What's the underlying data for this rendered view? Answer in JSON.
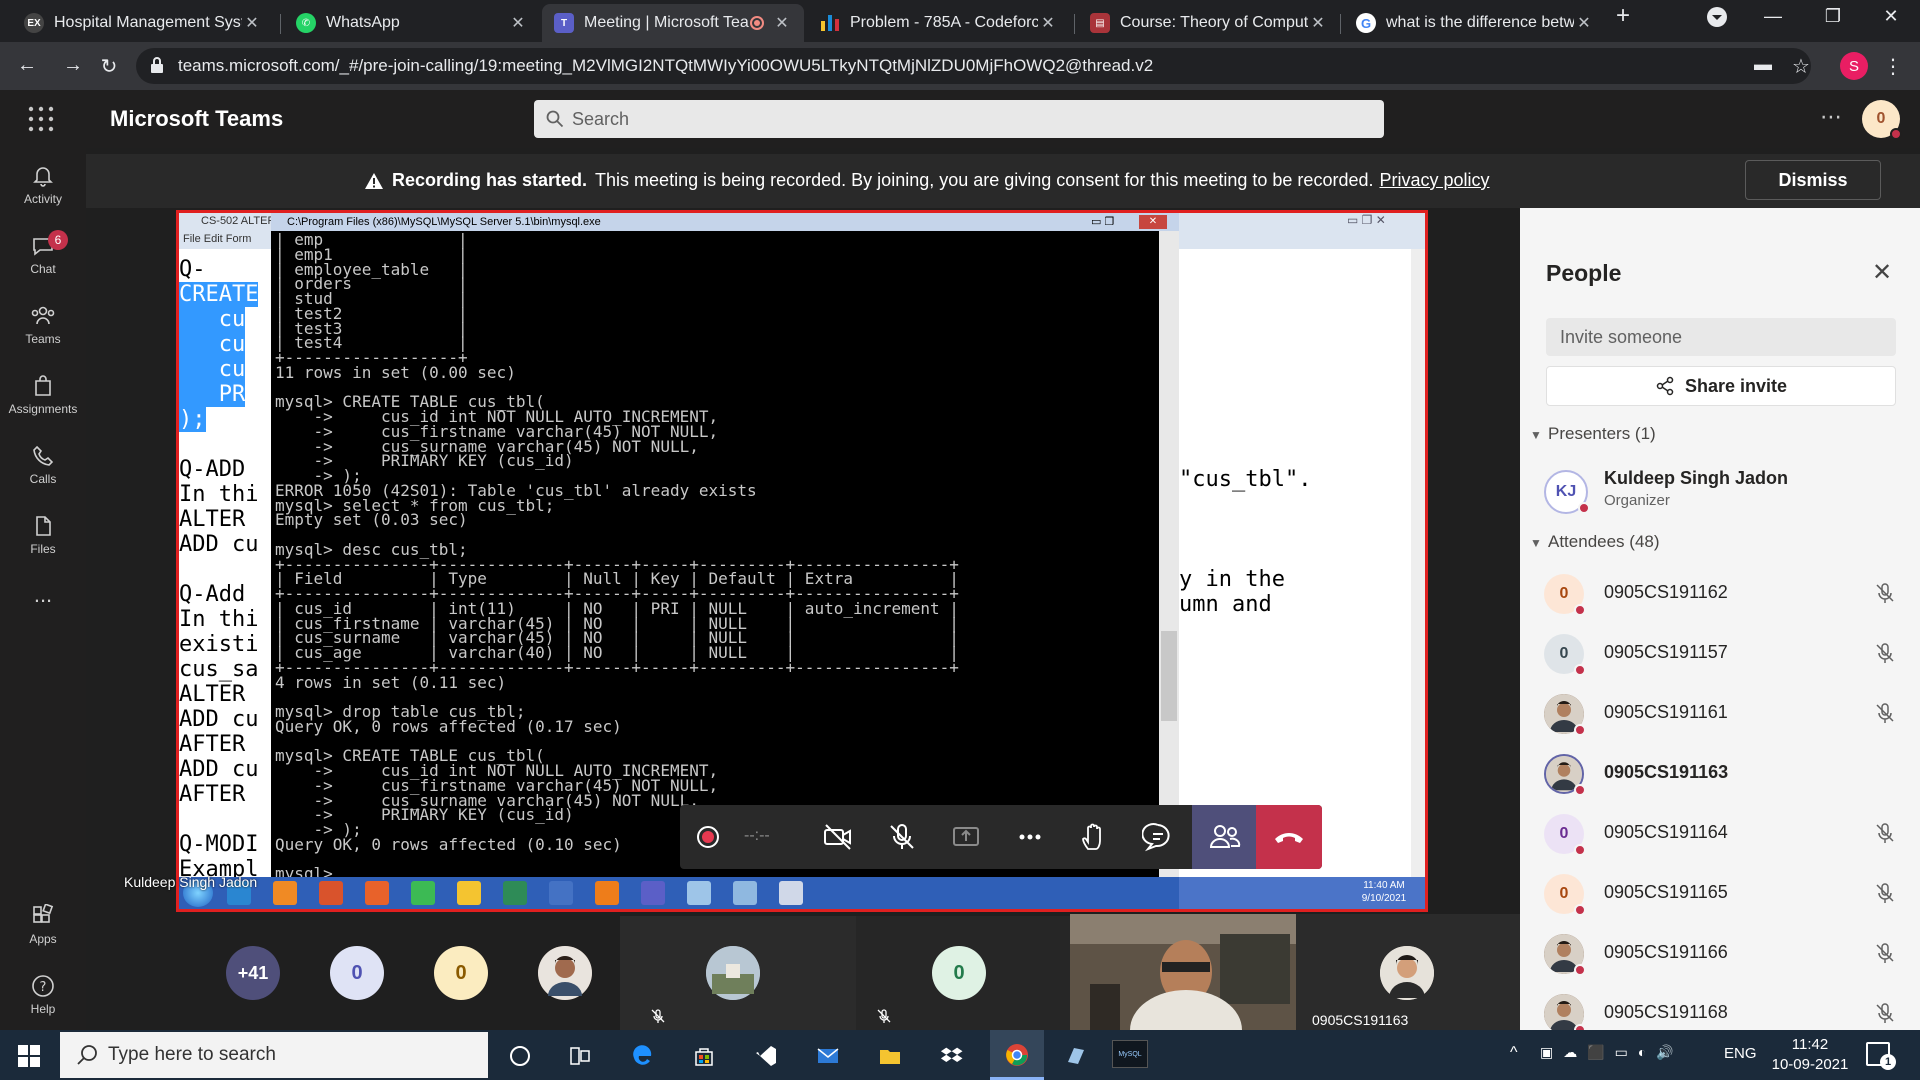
{
  "browser": {
    "tabs": [
      {
        "title": "Hospital Management Syste",
        "favicon": "ex-icon",
        "active": false
      },
      {
        "title": "WhatsApp",
        "favicon": "whatsapp-icon",
        "active": false
      },
      {
        "title": "Meeting | Microsoft Tea",
        "favicon": "teams-icon",
        "active": true
      },
      {
        "title": "Problem - 785A - Codeforc",
        "favicon": "codeforces-icon",
        "active": false
      },
      {
        "title": "Course: Theory of Computa",
        "favicon": "course-icon",
        "active": false
      },
      {
        "title": "what is the difference betw",
        "favicon": "google-icon",
        "active": false
      }
    ],
    "url": "teams.microsoft.com/_#/pre-join-calling/19:meeting_M2VlMGI2NTQtMWIyYi00OWU5LTkyNTQtMjNlZDU0MjFhOWQ2@thread.v2",
    "profile_initial": "S"
  },
  "teams": {
    "app_name": "Microsoft Teams",
    "search_placeholder": "Search",
    "user_initial": "0",
    "rail": [
      {
        "label": "Activity"
      },
      {
        "label": "Chat",
        "badge": "6"
      },
      {
        "label": "Teams"
      },
      {
        "label": "Assignments"
      },
      {
        "label": "Calls"
      },
      {
        "label": "Files"
      },
      {
        "label": "..."
      },
      {
        "label": "Apps"
      },
      {
        "label": "Help"
      }
    ]
  },
  "banner": {
    "bold": "Recording has started.",
    "text": "This meeting is being recorded. By joining, you are giving consent for this meeting to be recorded.",
    "link": "Privacy policy",
    "dismiss": "Dismiss"
  },
  "share": {
    "notepad_title": "CS-502 ALTER",
    "notepad_menu": "File  Edit  Form",
    "cmd_title": "C:\\Program Files (x86)\\MySQL\\MySQL Server 5.1\\bin\\mysql.exe",
    "left_lines": [
      "Q-",
      "CREATE",
      "   cu",
      "   cu",
      "   cu",
      "   PR",
      ");",
      "",
      "Q-ADD",
      "In thi",
      "ALTER",
      "ADD cu",
      "",
      "Q-Add",
      "In thi",
      "existi",
      "cus_sa",
      "ALTER",
      "ADD cu",
      "AFTER",
      "ADD cu",
      "AFTER",
      "",
      "Q-MODI",
      "Exampl"
    ],
    "right_lines": [
      "\"cus_tbl\".",
      "",
      "",
      "",
      "y in the",
      "umn and"
    ],
    "cmd_lines": [
      "| emp              |",
      "| emp1             |",
      "| employee_table   |",
      "| orders           |",
      "| stud             |",
      "| test2            |",
      "| test3            |",
      "| test4            |",
      "+------------------+",
      "11 rows in set (0.00 sec)",
      "",
      "mysql> CREATE TABLE cus_tbl(",
      "    ->     cus_id int NOT NULL AUTO_INCREMENT,",
      "    ->     cus_firstname varchar(45) NOT NULL,",
      "    ->     cus_surname varchar(45) NOT NULL,",
      "    ->     PRIMARY KEY (cus_id)",
      "    -> );",
      "ERROR 1050 (42S01): Table 'cus_tbl' already exists",
      "mysql> select * from cus_tbl;",
      "Empty set (0.03 sec)",
      "",
      "mysql> desc cus_tbl;",
      "+---------------+-------------+------+-----+---------+----------------+",
      "| Field         | Type        | Null | Key | Default | Extra          |",
      "+---------------+-------------+------+-----+---------+----------------+",
      "| cus_id        | int(11)     | NO   | PRI | NULL    | auto_increment |",
      "| cus_firstname | varchar(45) | NO   |     | NULL    |                |",
      "| cus_surname   | varchar(45) | NO   |     | NULL    |                |",
      "| cus_age       | varchar(40) | NO   |     | NULL    |                |",
      "+---------------+-------------+------+-----+---------+----------------+",
      "4 rows in set (0.11 sec)",
      "",
      "mysql> drop table cus_tbl;",
      "Query OK, 0 rows affected (0.17 sec)",
      "",
      "mysql> CREATE TABLE cus_tbl(",
      "    ->     cus_id int NOT NULL AUTO_INCREMENT,",
      "    ->     cus_firstname varchar(45) NOT NULL,",
      "    ->     cus_surname varchar(45) NOT NULL,",
      "    ->     PRIMARY KEY (cus_id)",
      "    -> );",
      "Query OK, 0 rows affected (0.10 sec)",
      "",
      "mysql> _"
    ],
    "xp_clock": "11:40 AM",
    "xp_date": "9/10/2021",
    "presenter": "Kuldeep Singh Jadon"
  },
  "controls": {
    "timer": "--:--"
  },
  "strip": {
    "overflow": "+41",
    "zero_label": "0",
    "video_name": "0905CS191163"
  },
  "people": {
    "title": "People",
    "invite_placeholder": "Invite someone",
    "share_invite": "Share invite",
    "presenters_label": "Presenters (1)",
    "presenter": {
      "initials": "KJ",
      "name": "Kuldeep Singh Jadon",
      "role": "Organizer"
    },
    "attendees_label": "Attendees (48)",
    "attendees": [
      {
        "name": "0905CS191162",
        "avatar": "0",
        "kind": "orange"
      },
      {
        "name": "0905CS191157",
        "avatar": "0",
        "kind": "gray"
      },
      {
        "name": "0905CS191161",
        "avatar": "",
        "kind": "photo"
      },
      {
        "name": "0905CS191163",
        "avatar": "",
        "kind": "photo-active"
      },
      {
        "name": "0905CS191164",
        "avatar": "0",
        "kind": "purple"
      },
      {
        "name": "0905CS191165",
        "avatar": "0",
        "kind": "orange"
      },
      {
        "name": "0905CS191166",
        "avatar": "",
        "kind": "photo"
      },
      {
        "name": "0905CS191168",
        "avatar": "",
        "kind": "photo"
      }
    ]
  },
  "windows": {
    "search_placeholder": "Type here to search",
    "lang": "ENG",
    "time": "11:42",
    "date": "10-09-2021",
    "notification_count": "1"
  },
  "colors": {
    "teams_purple": "#6264a7",
    "leave_red": "#c4314b",
    "share_border": "#e02020"
  }
}
